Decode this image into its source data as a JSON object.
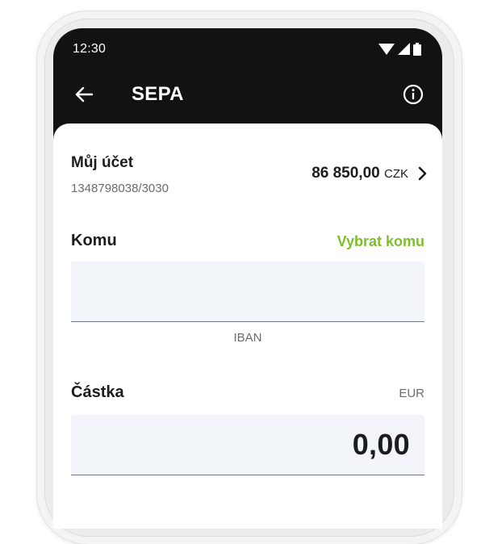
{
  "status_bar": {
    "time": "12:30"
  },
  "app_bar": {
    "title": "SEPA"
  },
  "account": {
    "label": "Můj účet",
    "number": "1348798038/3030",
    "balance_amount": "86 850,00",
    "balance_currency": "CZK"
  },
  "recipient": {
    "title": "Komu",
    "select_label": "Vybrat komu",
    "iban_value": "",
    "iban_hint": "IBAN"
  },
  "amount": {
    "title": "Částka",
    "currency": "EUR",
    "value": "0,00"
  },
  "colors": {
    "accent_green": "#7cbf2a",
    "header_background": "#121212",
    "field_background": "#f2f6fa"
  }
}
